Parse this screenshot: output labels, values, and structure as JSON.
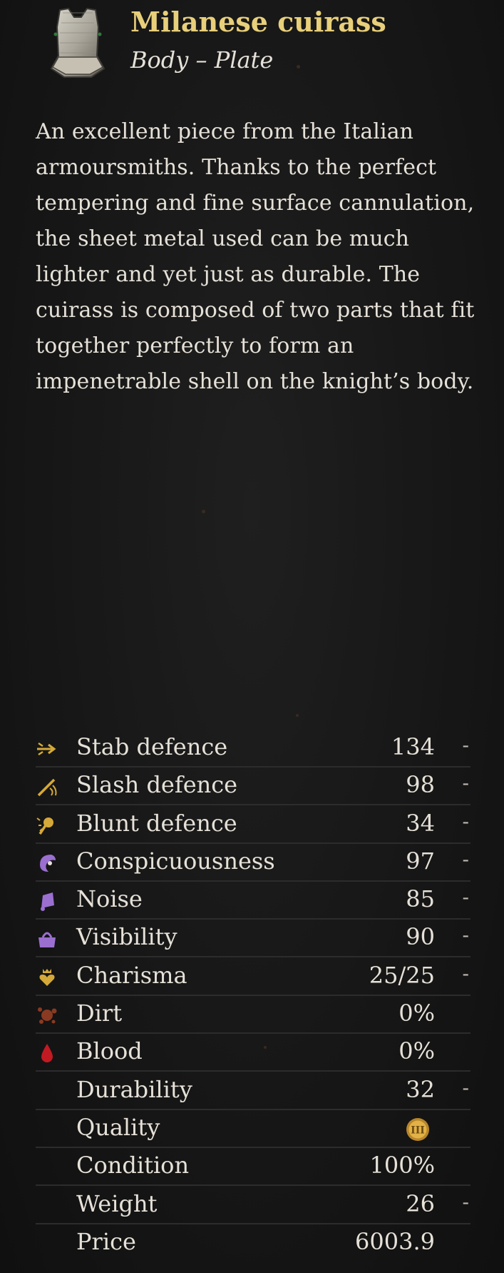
{
  "item": {
    "name": "Milanese cuirass",
    "category": "Body – Plate",
    "icon": "cuirass-icon",
    "description": "An excellent piece from the Italian armoursmiths. Thanks to the perfect tempering and fine surface cannulation, the sheet metal used can be much lighter and yet just as durable. The cuirass is composed of two parts that fit together perfectly to form an impenetrable shell on the knight’s body."
  },
  "colors": {
    "title": "#e8cf7a",
    "text": "#e6e1d8",
    "background": "#161616",
    "icon_gold": "#d4a93a",
    "icon_purple": "#9b6fd0",
    "icon_red": "#c21a22",
    "icon_brown": "#8a3a22"
  },
  "stats": [
    {
      "label": "Stab defence",
      "value": "134",
      "compare": "-",
      "icon": "stab-icon"
    },
    {
      "label": "Slash defence",
      "value": "98",
      "compare": "-",
      "icon": "slash-icon"
    },
    {
      "label": "Blunt defence",
      "value": "34",
      "compare": "-",
      "icon": "blunt-icon"
    },
    {
      "label": "Conspicuousness",
      "value": "97",
      "compare": "-",
      "icon": "conspicuousness-icon"
    },
    {
      "label": "Noise",
      "value": "85",
      "compare": "-",
      "icon": "noise-icon"
    },
    {
      "label": "Visibility",
      "value": "90",
      "compare": "-",
      "icon": "visibility-icon"
    },
    {
      "label": "Charisma",
      "value": "25/25",
      "compare": "-",
      "icon": "charisma-icon"
    },
    {
      "label": "Dirt",
      "value": "0%",
      "compare": "",
      "icon": "dirt-icon"
    },
    {
      "label": "Blood",
      "value": "0%",
      "compare": "",
      "icon": "blood-icon"
    },
    {
      "label": "Durability",
      "value": "32",
      "compare": "-",
      "icon": ""
    },
    {
      "label": "Quality",
      "value": "",
      "compare": "",
      "icon": "",
      "badge": "III"
    },
    {
      "label": "Condition",
      "value": "100%",
      "compare": "",
      "icon": ""
    },
    {
      "label": "Weight",
      "value": "26",
      "compare": "-",
      "icon": ""
    },
    {
      "label": "Price",
      "value": "6003.9",
      "compare": "",
      "icon": ""
    }
  ]
}
